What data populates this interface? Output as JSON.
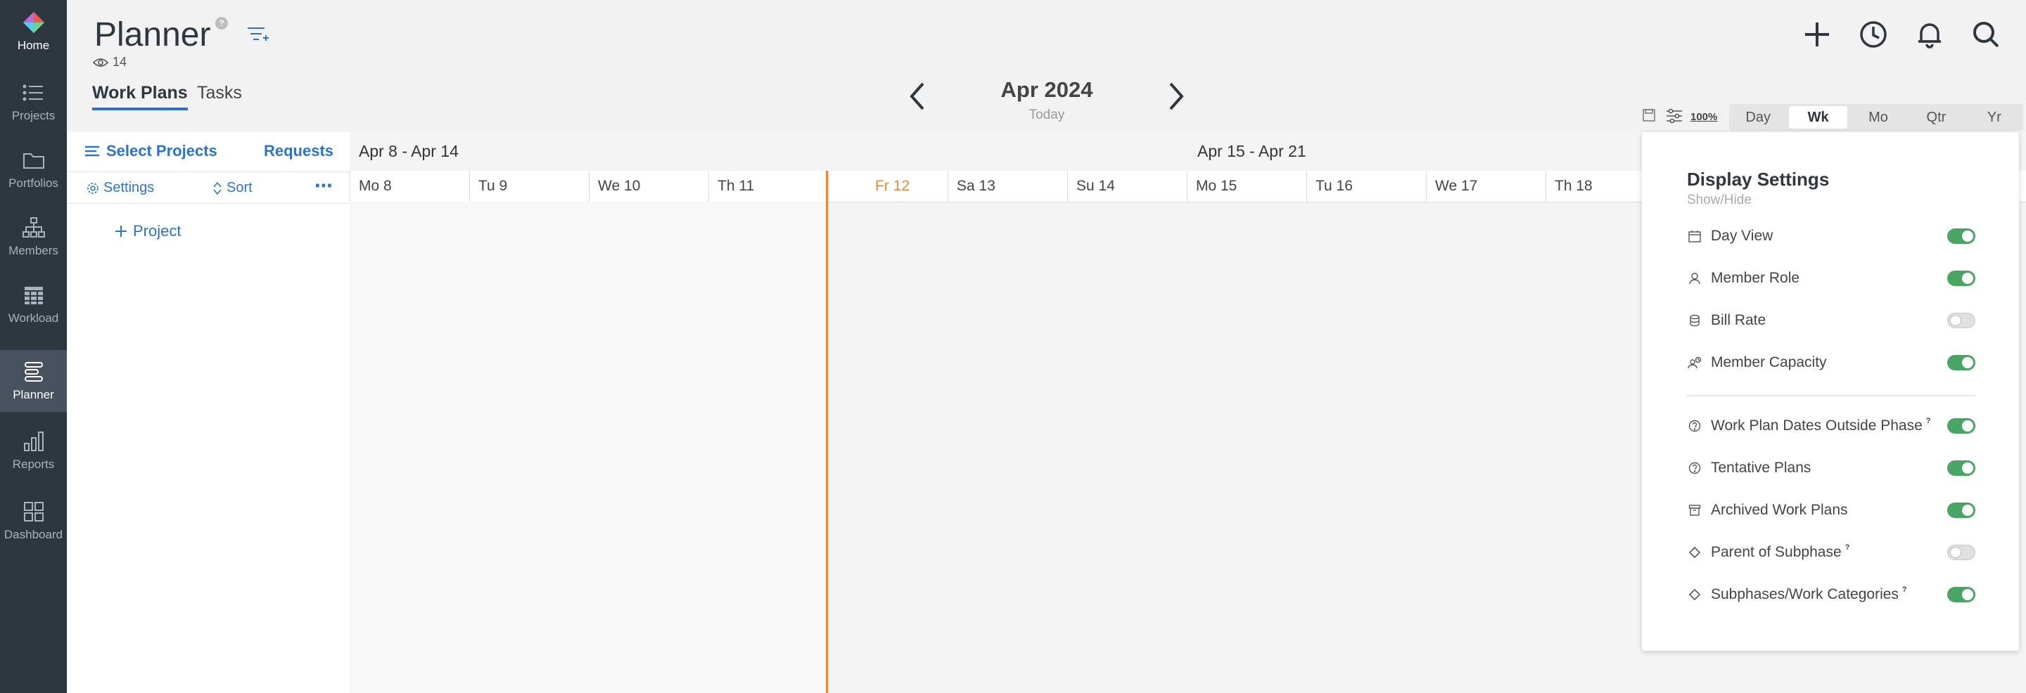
{
  "nav": {
    "items": [
      {
        "label": "Home",
        "icon": "app-logo-icon"
      },
      {
        "label": "Projects",
        "icon": "list-icon"
      },
      {
        "label": "Portfolios",
        "icon": "folder-icon"
      },
      {
        "label": "Members",
        "icon": "org-chart-icon"
      },
      {
        "label": "Workload",
        "icon": "grid-icon"
      },
      {
        "label": "Planner",
        "icon": "planner-icon",
        "active": true
      },
      {
        "label": "Reports",
        "icon": "bar-chart-icon"
      },
      {
        "label": "Dashboard",
        "icon": "dashboard-icon"
      }
    ]
  },
  "header": {
    "title": "Planner",
    "help_badge": "?",
    "views_count": "14",
    "tabs": [
      {
        "label": "Work Plans",
        "active": true
      },
      {
        "label": "Tasks"
      }
    ],
    "month": "Apr 2024",
    "today_label": "Today"
  },
  "toolbar": {
    "zoom": "100%",
    "scales": [
      {
        "label": "Day"
      },
      {
        "label": "Wk",
        "active": true
      },
      {
        "label": "Mo"
      },
      {
        "label": "Qtr"
      },
      {
        "label": "Yr"
      }
    ]
  },
  "panel": {
    "select_projects": "Select Projects",
    "requests": "Requests",
    "settings": "Settings",
    "sort": "Sort",
    "add_project": "Project"
  },
  "grid": {
    "weeks": [
      "Apr 8 - Apr 14",
      "Apr 15 - Apr 21"
    ],
    "days": [
      "Mo 8",
      "Tu 9",
      "We 10",
      "Th 11",
      "Fr 12",
      "Sa 13",
      "Su 14",
      "Mo 15",
      "Tu 16",
      "We 17",
      "Th 18"
    ],
    "today_index": 4
  },
  "display_settings": {
    "title": "Display Settings",
    "subtitle": "Show/Hide",
    "items": [
      {
        "label": "Day View",
        "icon": "calendar-icon",
        "on": true
      },
      {
        "label": "Member Role",
        "icon": "person-icon",
        "on": true
      },
      {
        "label": "Bill Rate",
        "icon": "database-icon",
        "on": false
      },
      {
        "label": "Member Capacity",
        "icon": "capacity-icon",
        "on": true
      },
      {
        "label": "Work Plan Dates Outside Phase",
        "icon": "question-icon",
        "on": true,
        "help": "?"
      },
      {
        "label": "Tentative Plans",
        "icon": "question-icon",
        "on": true
      },
      {
        "label": "Archived Work Plans",
        "icon": "archive-icon",
        "on": true
      },
      {
        "label": "Parent of Subphase",
        "icon": "diamond-icon",
        "on": false,
        "help": "?"
      },
      {
        "label": "Subphases/Work Categories",
        "icon": "diamond-icon",
        "on": true,
        "help": "?"
      }
    ]
  },
  "colors": {
    "nav_bg": "#2e3640",
    "accent": "#2c74c9",
    "today": "#e48a3c",
    "toggle_on": "#4aa564"
  }
}
